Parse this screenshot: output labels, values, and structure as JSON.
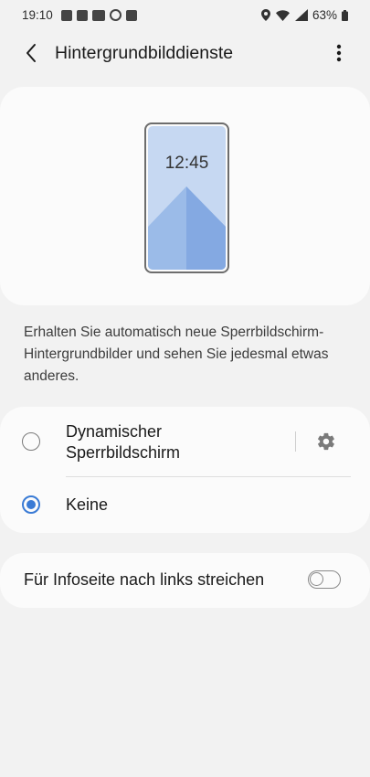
{
  "status_bar": {
    "time": "19:10",
    "battery": "63%",
    "notification_icons": [
      "chat-icon",
      "mail-icon",
      "voicemail-icon",
      "sync-icon",
      "image-icon"
    ],
    "system_icons": [
      "location-icon",
      "wifi-icon",
      "signal-icon",
      "battery-icon"
    ]
  },
  "header": {
    "title": "Hintergrundbilddienste"
  },
  "preview": {
    "time": "12:45"
  },
  "description": "Erhalten Sie automatisch neue Sperrbildschirm-Hintergrundbilder und sehen Sie jedesmal etwas anderes.",
  "options": [
    {
      "label": "Dynamischer Sperrbildschirm",
      "selected": false
    },
    {
      "label": "Keine",
      "selected": true
    }
  ],
  "swipe_setting": {
    "label": "Für Infoseite nach links streichen",
    "enabled": false
  },
  "colors": {
    "background": "#f2f2f2",
    "card": "#fbfbfb",
    "accent": "#3a7bd5",
    "wallpaper_top": "#c6d8f2",
    "wallpaper_mountain": "#9bbbe8",
    "wallpaper_shade": "#84a9e2"
  }
}
